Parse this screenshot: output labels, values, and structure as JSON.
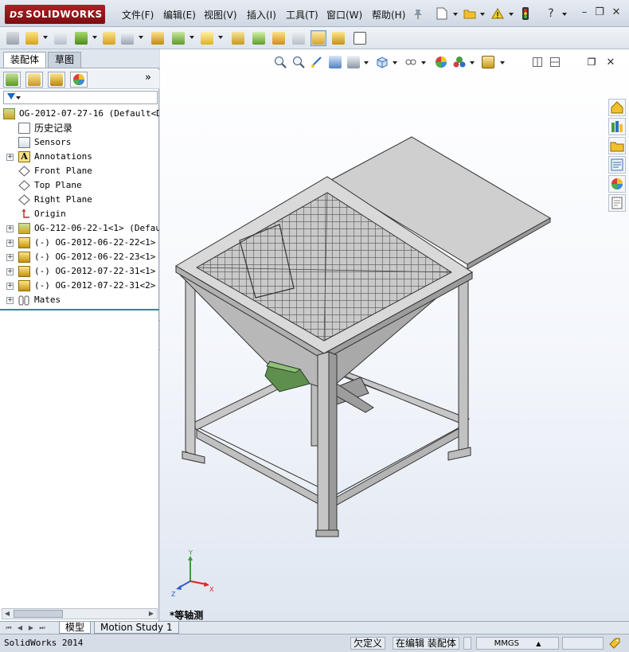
{
  "titlebar": {
    "logo_text": "SOLIDWORKS",
    "logo_prefix": "DS",
    "menus": [
      "文件(F)",
      "编辑(E)",
      "视图(V)",
      "插入(I)",
      "工具(T)",
      "窗口(W)",
      "帮助(H)"
    ],
    "brand_color": "#9c1a1f"
  },
  "left_panel": {
    "tabs": [
      "装配体",
      "草图"
    ],
    "more_arrows": "»",
    "tree": [
      {
        "label": "OG-2012-07-27-16  (Default<Di",
        "icon": "assembly-icon",
        "expandable": false
      },
      {
        "label": "历史记录",
        "icon": "history-icon",
        "expandable": false
      },
      {
        "label": "Sensors",
        "icon": "sensor-icon",
        "expandable": false
      },
      {
        "label": "Annotations",
        "icon": "annotation-icon",
        "expandable": true
      },
      {
        "label": "Front Plane",
        "icon": "plane-icon",
        "expandable": false
      },
      {
        "label": "Top Plane",
        "icon": "plane-icon",
        "expandable": false
      },
      {
        "label": "Right Plane",
        "icon": "plane-icon",
        "expandable": false
      },
      {
        "label": "Origin",
        "icon": "origin-icon",
        "expandable": false
      },
      {
        "label": "OG-212-06-22-1<1> (Default",
        "icon": "subassembly-icon",
        "expandable": true
      },
      {
        "label": "(-) OG-2012-06-22-22<1> (D",
        "icon": "part-icon",
        "expandable": true
      },
      {
        "label": "(-) OG-2012-06-22-23<1> (D",
        "icon": "part-icon",
        "expandable": true
      },
      {
        "label": "(-) OG-2012-07-22-31<1> (D",
        "icon": "part-icon",
        "expandable": true
      },
      {
        "label": "(-) OG-2012-07-22-31<2> (D",
        "icon": "part-icon",
        "expandable": true
      },
      {
        "label": "Mates",
        "icon": "mates-icon",
        "expandable": true
      }
    ]
  },
  "viewport": {
    "view_label": "*等轴测",
    "triad_axes": {
      "x": "X",
      "y": "Y",
      "z": "Z"
    }
  },
  "bottom_tabs": [
    "模型",
    "Motion Study 1"
  ],
  "statusbar": {
    "app": "SolidWorks 2014",
    "state": "欠定义",
    "mode": "在编辑 装配体",
    "units": "MMGS",
    "unit_arrow": "▲"
  }
}
